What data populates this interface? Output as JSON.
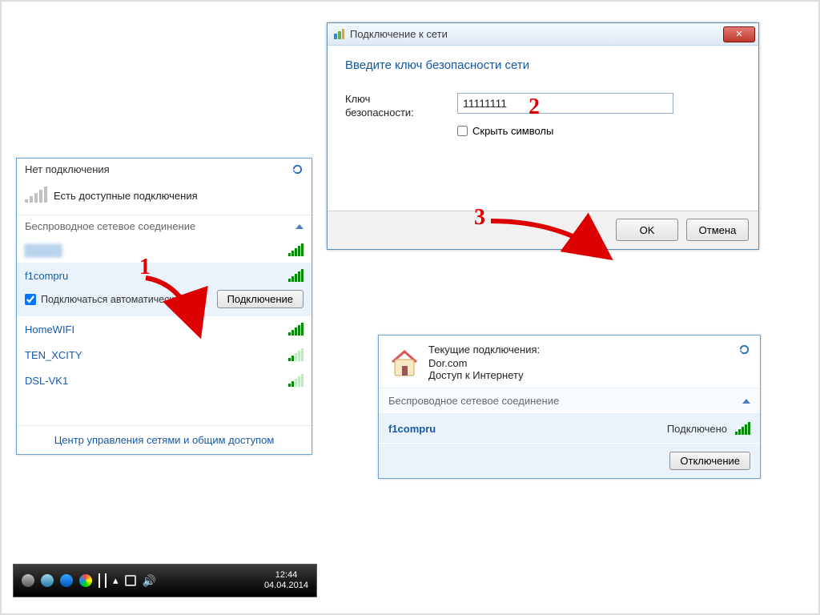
{
  "annotations": {
    "n1": "1",
    "n2": "2",
    "n3": "3"
  },
  "panel1": {
    "header": "Нет подключения",
    "status": "Есть доступные подключения",
    "category": "Беспроводное сетевое соединение",
    "blurred_name": "—",
    "networks": {
      "selected": "f1compru",
      "home": "HomeWIFI",
      "ten": "TEN_XCITY",
      "dsl": "DSL-VK1"
    },
    "auto_connect_label": "Подключаться автоматически",
    "connect_btn": "Подключение",
    "footer": "Центр управления сетями и общим доступом"
  },
  "taskbar": {
    "time": "12:44",
    "date": "04.04.2014"
  },
  "dialog": {
    "title": "Подключение к сети",
    "heading": "Введите ключ безопасности сети",
    "field_label": "Ключ безопасности:",
    "key_value": "11111111",
    "hide_label": "Скрыть символы",
    "ok": "OK",
    "cancel": "Отмена"
  },
  "panel3": {
    "heading": "Текущие подключения:",
    "conn_name": "Dor.com",
    "conn_status": "Доступ к Интернету",
    "category": "Беспроводное сетевое соединение",
    "net": "f1compru",
    "state": "Подключено",
    "disconnect": "Отключение"
  }
}
